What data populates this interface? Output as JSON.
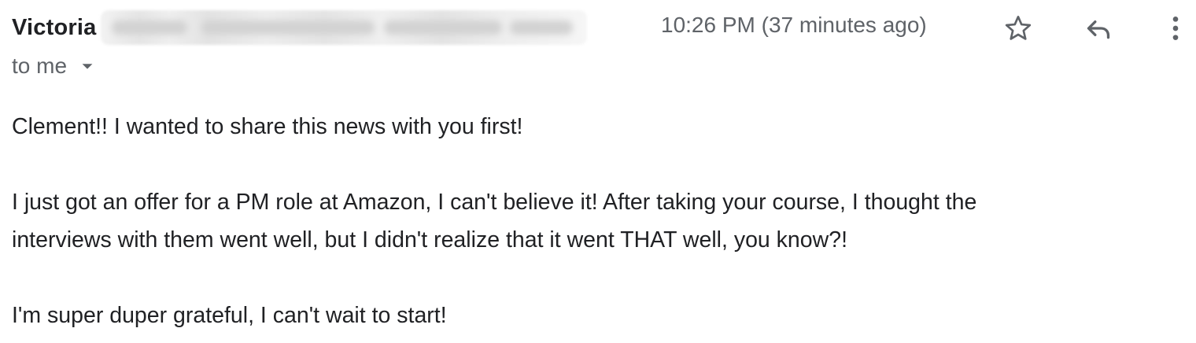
{
  "sender": {
    "name": "Victoria",
    "email_redacted": true
  },
  "meta": {
    "timestamp": "10:26 PM (37 minutes ago)",
    "recipient_label": "to me"
  },
  "actions": {
    "star_icon": "star-icon",
    "reply_icon": "reply-icon",
    "more_icon": "more-vert-icon",
    "dropdown_icon": "arrow-drop-down-icon"
  },
  "message": {
    "line1": "Clement!! I wanted to share this news with you first!",
    "line2": "I just got an offer for a PM role at Amazon, I can't believe it! After taking your course, I thought the",
    "line3": "interviews with them went well, but I didn't realize that it went THAT well, you know?!",
    "line4": "I'm super duper grateful, I can't wait to start!"
  },
  "colors": {
    "text_primary": "#202124",
    "text_secondary": "#5f6368",
    "icon": "#5f6368"
  }
}
